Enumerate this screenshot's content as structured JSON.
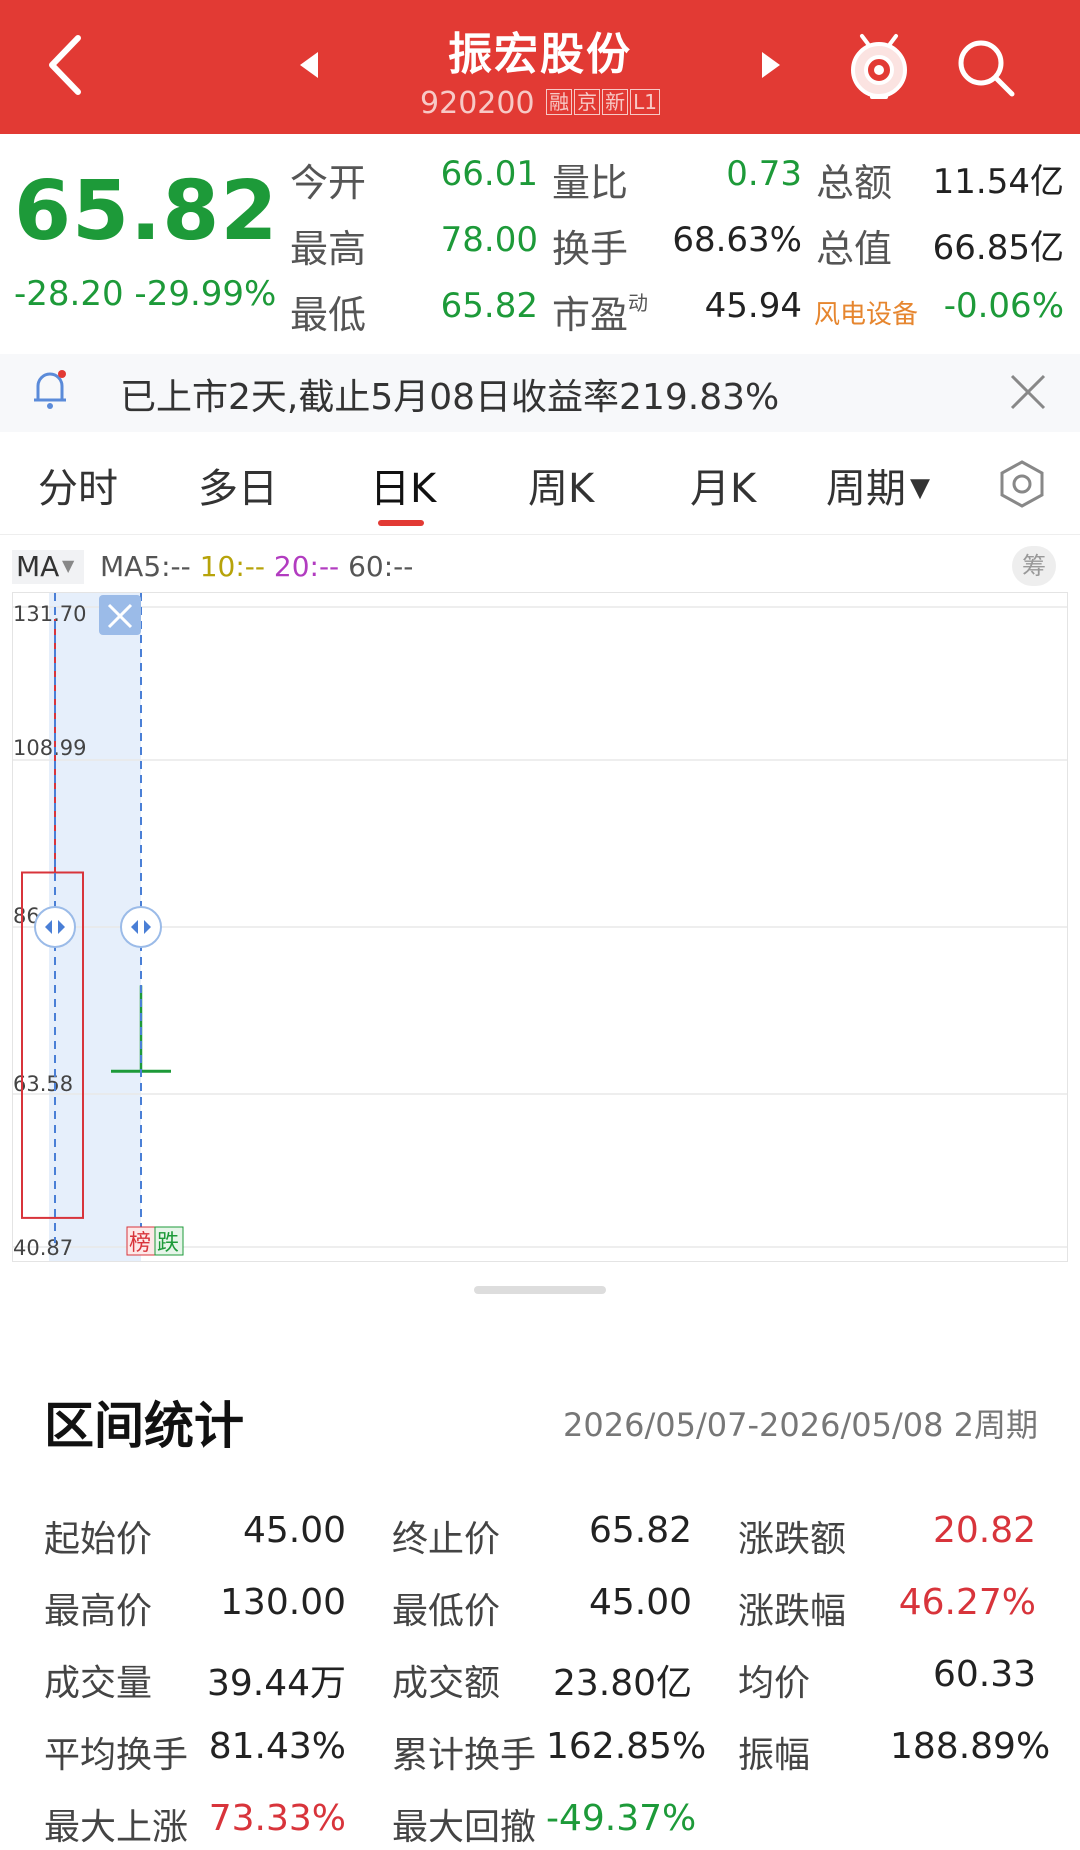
{
  "header": {
    "title": "振宏股份",
    "code": "920200",
    "tags": [
      "融",
      "京",
      "新",
      "L1"
    ],
    "bg_color": "#e23a34"
  },
  "quote": {
    "price": "65.82",
    "change": "-28.20",
    "change_pct": "-29.99%",
    "fields": {
      "open_label": "今开",
      "open": "66.01",
      "high_label": "最高",
      "high": "78.00",
      "low_label": "最低",
      "low": "65.82",
      "vol_ratio_label": "量比",
      "vol_ratio": "0.73",
      "turnover_label": "换手",
      "turnover": "68.63%",
      "pe_label": "市盈",
      "pe_sup": "动",
      "pe": "45.94",
      "amount_label": "总额",
      "amount": "11.54亿",
      "mktcap_label": "总值",
      "mktcap": "66.85亿",
      "industry": "风电设备",
      "industry_change": "-0.06%"
    },
    "colors": {
      "down": "#1d9a39",
      "up": "#d8343b"
    }
  },
  "notice": {
    "text": "已上市2天,截止5月08日收益率219.83%",
    "icons": [
      "bell-icon",
      "close-icon"
    ]
  },
  "tabs": {
    "items": [
      "分时",
      "多日",
      "日K",
      "周K",
      "月K",
      "周期"
    ],
    "active": "日K"
  },
  "ma_row": {
    "select_label": "MA",
    "ma5_label": "MA5:--",
    "ma10_label": "10:--",
    "ma20_label": "20:--",
    "ma60_label": "60:--",
    "chip_label": "筹"
  },
  "chart_data": {
    "type": "candlestick",
    "y_ticks": [
      "131.70",
      "108.99",
      "86",
      "63.58",
      "40.87"
    ],
    "ylim": [
      40.87,
      131.7
    ],
    "candles": [
      {
        "open": 45.0,
        "high": 130.0,
        "low": 45.0,
        "close": 94.02,
        "color": "red"
      },
      {
        "open": 66.01,
        "high": 78.0,
        "low": 65.82,
        "close": 65.82,
        "color": "green"
      }
    ],
    "badges": [
      "榜",
      "跌"
    ],
    "grid": true
  },
  "stats": {
    "title": "区间统计",
    "range": "2026/05/07-2026/05/08 2周期",
    "rows": [
      [
        {
          "label": "起始价",
          "value": "45.00",
          "color": "black"
        },
        {
          "label": "终止价",
          "value": "65.82",
          "color": "black"
        },
        {
          "label": "涨跌额",
          "value": "20.82",
          "color": "red"
        }
      ],
      [
        {
          "label": "最高价",
          "value": "130.00",
          "color": "black"
        },
        {
          "label": "最低价",
          "value": "45.00",
          "color": "black"
        },
        {
          "label": "涨跌幅",
          "value": "46.27%",
          "color": "red"
        }
      ],
      [
        {
          "label": "成交量",
          "value": "39.44万",
          "color": "black"
        },
        {
          "label": "成交额",
          "value": "23.80亿",
          "color": "black"
        },
        {
          "label": "均价",
          "value": "60.33",
          "color": "black"
        }
      ],
      [
        {
          "label": "平均换手",
          "value": "81.43%",
          "color": "black"
        },
        {
          "label": "累计换手",
          "value": "162.85%",
          "color": "black"
        },
        {
          "label": "振幅",
          "value": "188.89%",
          "color": "black"
        }
      ],
      [
        {
          "label": "最大上涨",
          "value": "73.33%",
          "color": "red"
        },
        {
          "label": "最大回撤",
          "value": "-49.37%",
          "color": "green"
        }
      ]
    ]
  }
}
